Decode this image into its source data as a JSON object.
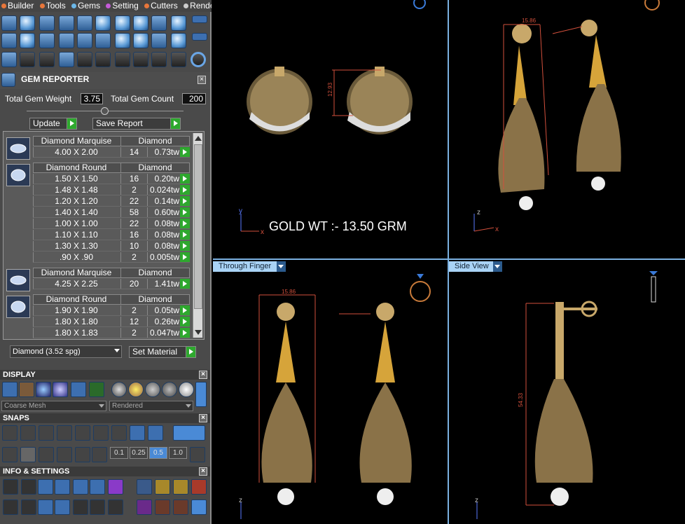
{
  "menu": [
    {
      "label": "Builder",
      "color": "#e8763a"
    },
    {
      "label": "Tools",
      "color": "#e8763a"
    },
    {
      "label": "Gems",
      "color": "#6bb7e8"
    },
    {
      "label": "Setting",
      "color": "#c45bd8"
    },
    {
      "label": "Cutters",
      "color": "#e8763a"
    },
    {
      "label": "Render",
      "color": "#cccccc"
    }
  ],
  "gem_reporter": {
    "title": "GEM REPORTER",
    "total_weight_label": "Total Gem Weight",
    "total_weight": "3.75",
    "total_count_label": "Total Gem Count",
    "total_count": "200",
    "update": "Update",
    "save_report": "Save Report",
    "material": "Diamond    (3.52 spg)",
    "set_material": "Set Material"
  },
  "groups": [
    {
      "shape": "Diamond Marquise",
      "material": "Diamond",
      "icon": "marquise-gem-icon",
      "rows": [
        {
          "size": "4.00 X 2.00",
          "count": "14",
          "weight": "0.73tw"
        }
      ]
    },
    {
      "shape": "Diamond Round",
      "material": "Diamond",
      "icon": "round-gem-icon",
      "rows": [
        {
          "size": "1.50 X 1.50",
          "count": "16",
          "weight": "0.20tw"
        },
        {
          "size": "1.48 X 1.48",
          "count": "2",
          "weight": "0.024tw"
        },
        {
          "size": "1.20 X 1.20",
          "count": "22",
          "weight": "0.14tw"
        },
        {
          "size": "1.40 X 1.40",
          "count": "58",
          "weight": "0.60tw"
        },
        {
          "size": "1.00 X 1.00",
          "count": "22",
          "weight": "0.08tw"
        },
        {
          "size": "1.10 X 1.10",
          "count": "16",
          "weight": "0.08tw"
        },
        {
          "size": "1.30 X 1.30",
          "count": "10",
          "weight": "0.08tw"
        },
        {
          "size": ".90 X .90",
          "count": "2",
          "weight": "0.005tw"
        }
      ]
    },
    {
      "shape": "Diamond Marquise",
      "material": "Diamond",
      "icon": "marquise-gem-icon",
      "rows": [
        {
          "size": "4.25 X 2.25",
          "count": "20",
          "weight": "1.41tw"
        }
      ]
    },
    {
      "shape": "Diamond Round",
      "material": "Diamond",
      "icon": "round-gem-icon",
      "rows": [
        {
          "size": "1.90 X 1.90",
          "count": "2",
          "weight": "0.05tw"
        },
        {
          "size": "1.80 X 1.80",
          "count": "12",
          "weight": "0.26tw"
        },
        {
          "size": "1.80 X 1.83",
          "count": "2",
          "weight": "0.047tw"
        }
      ]
    }
  ],
  "display": {
    "title": "DISPLAY",
    "mesh": "Coarse Mesh",
    "mode": "Rendered"
  },
  "snaps": {
    "title": "SNAPS",
    "values": [
      "0.1",
      "0.25",
      "0.5",
      "1.0"
    ]
  },
  "info": {
    "title": "INFO & SETTINGS"
  },
  "viewports": {
    "top_left": {
      "gold_text": "GOLD WT :- 13.50 GRM",
      "dim": "12.93",
      "axis_v": "y",
      "axis_h": "x"
    },
    "top_right": {
      "dim": "15.86",
      "axis_v": "z",
      "axis_h": "x"
    },
    "bottom_left": {
      "label": "Through Finger",
      "dim": "15.86",
      "axis_v": "z"
    },
    "bottom_right": {
      "label": "Side View",
      "dim": "54.33",
      "axis_v": "z"
    }
  },
  "colors": {
    "panel": "#4a4a4a",
    "accent": "#2ea82e",
    "viewport_label": "#a9d3f5",
    "gold": "#c8a86a",
    "dim_line": "#d2503c"
  }
}
